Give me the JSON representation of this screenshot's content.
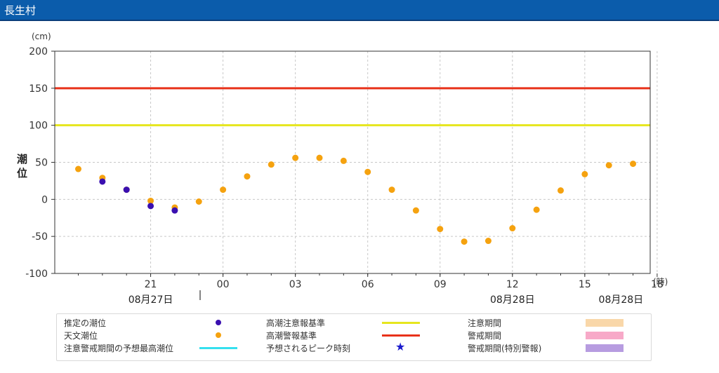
{
  "window": {
    "title": "長生村"
  },
  "chart_data": {
    "type": "scatter",
    "ylabel": "潮位",
    "yunit": "(cm)",
    "xunit": "(時)",
    "ylim": [
      -100,
      200
    ],
    "yticks": [
      -100,
      -50,
      0,
      50,
      100,
      150,
      200
    ],
    "grid": true,
    "x_ticks": [
      {
        "h": 21,
        "label": "21"
      },
      {
        "h": 24,
        "label": "00"
      },
      {
        "h": 27,
        "label": "03"
      },
      {
        "h": 30,
        "label": "06"
      },
      {
        "h": 33,
        "label": "09"
      },
      {
        "h": 36,
        "label": "12"
      },
      {
        "h": 39,
        "label": "15"
      },
      {
        "h": 42,
        "label": "18"
      }
    ],
    "date_labels": [
      {
        "h": 21,
        "label": "08月27日"
      },
      {
        "h": 36,
        "label": "08月28日"
      },
      {
        "h": 40.5,
        "label": "08月28日"
      }
    ],
    "reference_lines": [
      {
        "name": "高潮警報基準",
        "value": 150,
        "color": "#e8321a"
      },
      {
        "name": "高潮注意報基準",
        "value": 100,
        "color": "#e6e61e"
      }
    ],
    "series": [
      {
        "name": "天文潮位",
        "color": "#f5a20f",
        "points": [
          [
            18,
            41
          ],
          [
            19,
            29
          ],
          [
            20,
            13
          ],
          [
            21,
            -2
          ],
          [
            22,
            -11
          ],
          [
            23,
            -3
          ],
          [
            24,
            13
          ],
          [
            25,
            31
          ],
          [
            26,
            47
          ],
          [
            27,
            56
          ],
          [
            28,
            56
          ],
          [
            29,
            52
          ],
          [
            30,
            37
          ],
          [
            31,
            13
          ],
          [
            32,
            -15
          ],
          [
            33,
            -40
          ],
          [
            34,
            -57
          ],
          [
            35,
            -56
          ],
          [
            36,
            -39
          ],
          [
            37,
            -14
          ],
          [
            38,
            12
          ],
          [
            39,
            34
          ],
          [
            40,
            46
          ],
          [
            41,
            48
          ]
        ]
      },
      {
        "name": "推定の潮位",
        "color": "#3a0fb0",
        "points": [
          [
            19,
            24
          ],
          [
            20,
            13
          ],
          [
            21,
            -9
          ],
          [
            22,
            -15
          ]
        ]
      }
    ]
  },
  "legend": {
    "items": [
      {
        "label": "推定の潮位",
        "kind": "dot",
        "color": "#3a0fb0"
      },
      {
        "label": "天文潮位",
        "kind": "dot",
        "color": "#f5a20f"
      },
      {
        "label": "注意警戒期間の予想最高潮位",
        "kind": "line",
        "color": "#35e0ef"
      },
      {
        "label": "高潮注意報基準",
        "kind": "line",
        "color": "#e6e61e"
      },
      {
        "label": "高潮警報基準",
        "kind": "line",
        "color": "#e8321a"
      },
      {
        "label": "予想されるピーク時刻",
        "kind": "star",
        "color": "#1a1acd"
      },
      {
        "label": "注意期間",
        "kind": "box",
        "color": "#f9d7a9"
      },
      {
        "label": "警戒期間",
        "kind": "box",
        "color": "#f7a9c8"
      },
      {
        "label": "警戒期間(特別警報)",
        "kind": "box",
        "color": "#b79ce0"
      }
    ]
  }
}
